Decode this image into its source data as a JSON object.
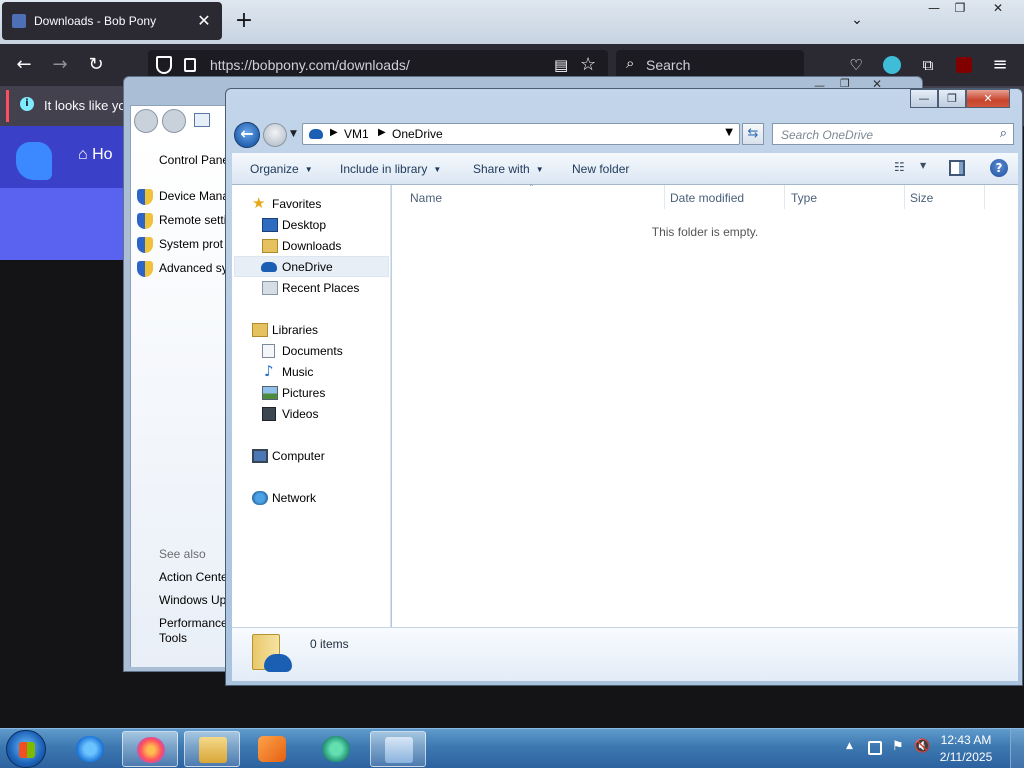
{
  "browser": {
    "tab_title": "Downloads - Bob Pony",
    "tab_close": "✕",
    "new_tab": "+",
    "tab_list": "⌄",
    "url": "https://bobpony.com/downloads/",
    "search_placeholder": "Search",
    "notice_text": "It looks like yo",
    "site_home": "Ho",
    "window_buttons": {
      "minimize": "—",
      "restore": "❐",
      "close": "✕"
    }
  },
  "control_panel": {
    "home_link": "Control Pane",
    "tasks": [
      "Device Mana",
      "Remote setti",
      "System prot",
      "Advanced sy"
    ],
    "see_also_heading": "See also",
    "see_also": [
      "Action Cente",
      "Windows Up",
      "Performance",
      "Tools"
    ]
  },
  "explorer": {
    "breadcrumb": [
      "VM1",
      "OneDrive"
    ],
    "search_placeholder": "Search OneDrive",
    "commands": {
      "organize": "Organize",
      "include_in_library": "Include in library",
      "share_with": "Share with",
      "new_folder": "New folder"
    },
    "navigation": {
      "favorites": "Favorites",
      "favorites_items": [
        "Desktop",
        "Downloads",
        "OneDrive",
        "Recent Places"
      ],
      "libraries": "Libraries",
      "libraries_items": [
        "Documents",
        "Music",
        "Pictures",
        "Videos"
      ],
      "computer": "Computer",
      "network": "Network"
    },
    "selected_nav_item": "OneDrive",
    "columns": [
      "Name",
      "Date modified",
      "Type",
      "Size"
    ],
    "empty_message": "This folder is empty.",
    "item_count": "0 items",
    "help": "?"
  },
  "taskbar": {
    "items": [
      "internet-explorer",
      "firefox",
      "windows-explorer",
      "media-player",
      "app-green",
      "control-panel"
    ],
    "active_item": "firefox",
    "clock_time": "12:43 AM",
    "clock_date": "2/11/2025",
    "tray_expand": "▲"
  },
  "colors": {
    "firefox_dark": "#2b2a33",
    "aero_taskbar": "#3d78b0",
    "selection_bg": "#e8eef6",
    "link_blue": "#1e395b"
  }
}
